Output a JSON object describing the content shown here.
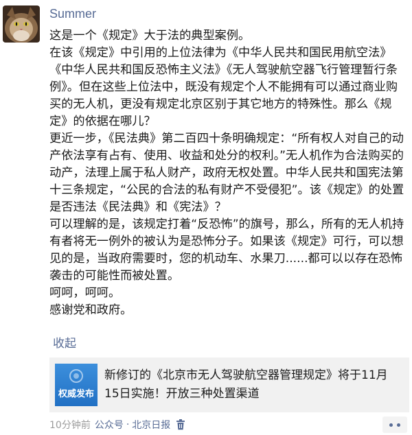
{
  "post": {
    "username": "Summer",
    "paragraphs": [
      "这是一个《规定》大于法的典型案例。",
      "在该《规定》中引用的上位法律为《中华人民共和国民用航空法》《中华人民共和国反恐怖主义法》《无人驾驶航空器飞行管理暂行条例》。但在这些上位法中，既没有规定个人不能拥有可以通过商业购买的无人机，更没有规定北京区别于其它地方的特殊性。那么《规定》的依据在哪儿？",
      "更近一步，《民法典》第二百四十条明确规定：“所有权人对自己的动产依法享有占有、使用、收益和处分的权利。”无人机作为合法购买的动产，法理上属于私人财产，政府无权处置。中华人民共和国宪法第十三条规定，“公民的合法的私有财产不受侵犯”。该《规定》的处置是否违法《民法典》和《宪法》？",
      "可以理解的是，该规定打着“反恐怖”的旗号，那么，所有的无人机持有者将无一例外的被认为是恐怖分子。如果该《规定》可行，可以想见的是，当政府需要时，您的机动车、水果刀......都可以以存在恐怖袭击的可能性而被处置。",
      "呵呵，呵呵。",
      "感谢党和政府。"
    ],
    "collapse_label": "收起"
  },
  "share_card": {
    "thumb_text": "权威发布",
    "title": "新修订的《北京市无人驾驶航空器管理规定》将于11月15日实施！开放三种处置渠道"
  },
  "footer": {
    "time": "10分钟前",
    "source_prefix": "公众号",
    "separator": "·",
    "source_name": "北京日报"
  },
  "icons": {
    "trash": "trash-icon",
    "more": "more-icon"
  },
  "colors": {
    "link": "#576b95",
    "card_bg": "#f1f1f1",
    "thumb_blue": "#2170c4"
  }
}
